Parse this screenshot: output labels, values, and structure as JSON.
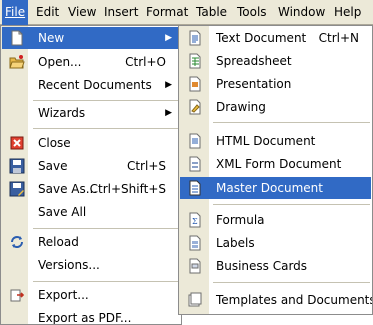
{
  "menubar": [
    {
      "label": "File"
    },
    {
      "label": "Edit"
    },
    {
      "label": "View"
    },
    {
      "label": "Insert"
    },
    {
      "label": "Format"
    },
    {
      "label": "Table"
    },
    {
      "label": "Tools"
    },
    {
      "label": "Window"
    },
    {
      "label": "Help"
    }
  ],
  "file_menu": {
    "new": {
      "label": "New"
    },
    "open": {
      "label": "Open...",
      "shortcut": "Ctrl+O"
    },
    "recent": {
      "label": "Recent Documents"
    },
    "wizards": {
      "label": "Wizards"
    },
    "close": {
      "label": "Close"
    },
    "save": {
      "label": "Save",
      "shortcut": "Ctrl+S"
    },
    "save_as": {
      "label": "Save As...",
      "shortcut": "Ctrl+Shift+S"
    },
    "save_all": {
      "label": "Save All"
    },
    "reload": {
      "label": "Reload"
    },
    "versions": {
      "label": "Versions..."
    },
    "export": {
      "label": "Export..."
    },
    "export_pdf": {
      "label": "Export as PDF..."
    }
  },
  "new_submenu": {
    "text": {
      "label": "Text Document",
      "shortcut": "Ctrl+N"
    },
    "spreadsheet": {
      "label": "Spreadsheet"
    },
    "presentation": {
      "label": "Presentation"
    },
    "drawing": {
      "label": "Drawing"
    },
    "html": {
      "label": "HTML Document"
    },
    "xml": {
      "label": "XML Form Document"
    },
    "master": {
      "label": "Master Document"
    },
    "formula": {
      "label": "Formula"
    },
    "labels": {
      "label": "Labels"
    },
    "business_cards": {
      "label": "Business Cards"
    },
    "templates": {
      "label": "Templates and Documents"
    }
  },
  "colors": {
    "highlight": "#316ac5",
    "menubar_bg": "#ece9d8"
  }
}
